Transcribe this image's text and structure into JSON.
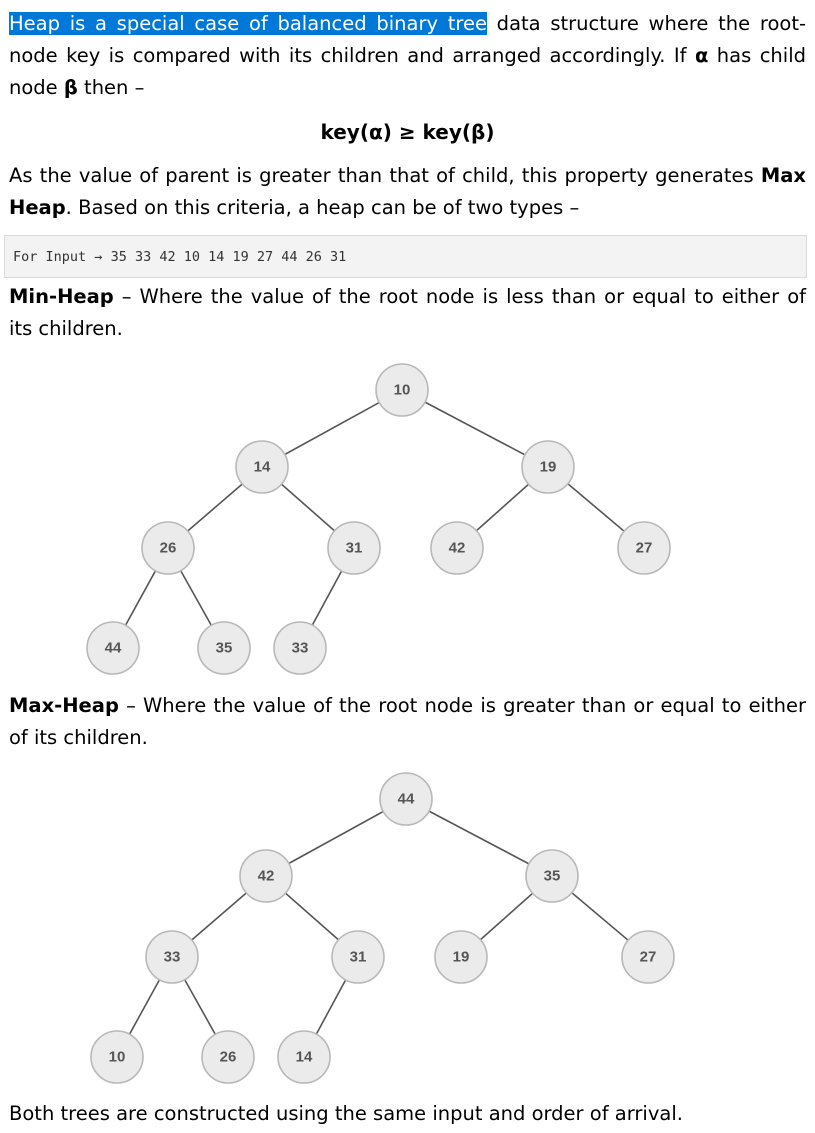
{
  "intro": {
    "highlighted": "Heap is a special case of balanced binary tree",
    "rest_1": " data structure where the root-node key is compared with its children and arranged accordingly. If ",
    "alpha": "α",
    "rest_2": " has child node ",
    "beta": "β",
    "rest_3": " then –"
  },
  "formula": "key(α) ≥ key(β)",
  "max_para": {
    "part_1": "As the value of parent is greater than that of child, this property generates ",
    "bold": "Max Heap",
    "part_2": ". Based on this criteria, a heap can be of two types –"
  },
  "code_box": {
    "label": "For Input",
    "arrow": "→",
    "values": "35 33 42 10 14 19 27 44 26 31"
  },
  "min_heap": {
    "title": "Min-Heap",
    "description": " – Where the value of the root node is less than or equal to either of its children.",
    "nodes": [
      "10",
      "14",
      "19",
      "26",
      "31",
      "42",
      "27",
      "44",
      "35",
      "33"
    ]
  },
  "max_heap": {
    "title": "Max-Heap",
    "description": " – Where the value of the root node is greater than or equal to either of its children.",
    "nodes": [
      "44",
      "42",
      "35",
      "33",
      "31",
      "19",
      "27",
      "10",
      "26",
      "14"
    ]
  },
  "conclusion": "Both trees are constructed using the same input and order of arrival.",
  "colors": {
    "highlight": "#0078d7",
    "node_fill": "#ebebeb",
    "node_stroke": "#b8b8b8",
    "edge": "#555555"
  }
}
